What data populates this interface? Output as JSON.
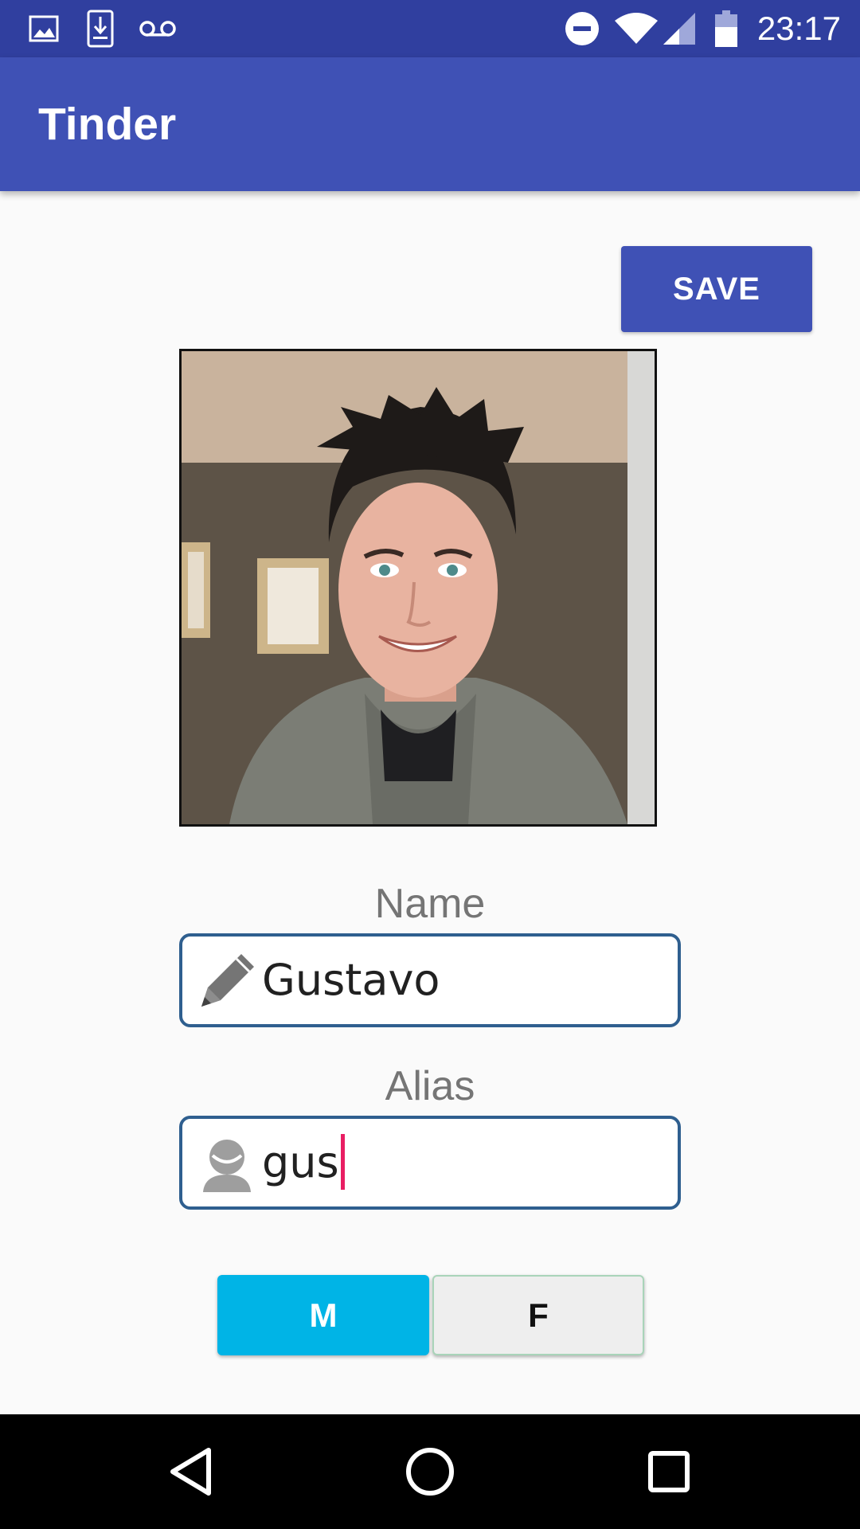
{
  "status_bar": {
    "time": "23:17",
    "left_icons": [
      "image-icon",
      "download-icon",
      "voicemail-icon"
    ],
    "right_icons": [
      "do-not-disturb-icon",
      "wifi-icon",
      "signal-icon",
      "battery-icon"
    ]
  },
  "app_bar": {
    "title": "Tinder"
  },
  "toolbar": {
    "save_label": "SAVE"
  },
  "profile": {
    "photo": "profile-photo"
  },
  "form": {
    "name": {
      "label": "Name",
      "value": "Gustavo",
      "icon": "pencil-icon"
    },
    "alias": {
      "label": "Alias",
      "value": "gus",
      "icon": "person-icon"
    },
    "gender": {
      "options": [
        "M",
        "F"
      ],
      "selected": "M"
    }
  },
  "nav_bar": {
    "buttons": [
      "back-icon",
      "home-icon",
      "recents-icon"
    ]
  },
  "colors": {
    "status_bar": "#303f9f",
    "app_bar": "#3f51b5",
    "save_button": "#3f51b5",
    "gender_selected": "#00b4e6",
    "gender_unselected": "#eeeeee",
    "field_border": "#2f5f8f",
    "cursor": "#e91e63"
  }
}
